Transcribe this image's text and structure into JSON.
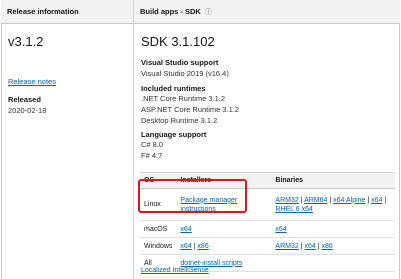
{
  "header": {
    "left_title": "Release information",
    "right_title": "Build apps - SDK",
    "right_info_icon": "info-circle-icon"
  },
  "release": {
    "version": "v3.1.2",
    "notes_link": "Release notes",
    "released_label": "Released",
    "released_date": "2020-02-18"
  },
  "sdk": {
    "title": "SDK 3.1.102",
    "vs_support_label": "Visual Studio support",
    "vs_support_value": "Visual Studio 2019 (v16.4)",
    "runtimes_label": "Included runtimes",
    "runtimes": [
      ".NET Core Runtime 3.1.2",
      "ASP.NET Core Runtime 3.1.2",
      "Desktop Runtime 3.1.2"
    ],
    "lang_label": "Language support",
    "languages": [
      "C# 8.0",
      "F# 4.7"
    ]
  },
  "table": {
    "headers": [
      "OS",
      "Installers",
      "Binaries"
    ],
    "rows": [
      {
        "os": "Linux",
        "installers": [
          "Package manager instructions"
        ],
        "binaries": [
          "ARM32",
          "ARM64",
          "x64 Alpine",
          "x64",
          "RHEL 6 x64"
        ]
      },
      {
        "os": "macOS",
        "installers": [
          "x64"
        ],
        "binaries": [
          "x64"
        ]
      },
      {
        "os": "Windows",
        "installers": [
          "x64",
          "x86"
        ],
        "binaries": [
          "ARM32",
          "x64",
          "x86"
        ]
      },
      {
        "os": "All",
        "installers": [
          "dotnet-install scripts"
        ],
        "binaries": []
      }
    ]
  },
  "footer_link": "Localized IntelliSense",
  "colors": {
    "link": "#0065b3",
    "highlight": "#d61b1b",
    "header_bg": "#f2f2f2"
  }
}
